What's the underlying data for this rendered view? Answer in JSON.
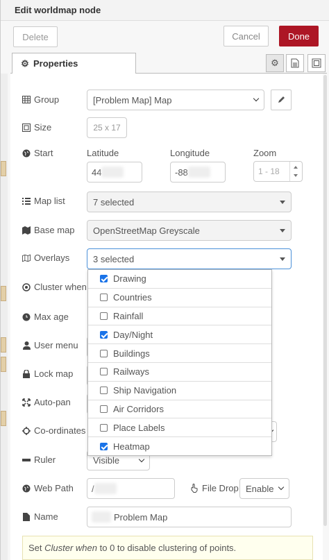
{
  "header": {
    "title": "Edit worldmap node",
    "delete_label": "Delete",
    "cancel_label": "Cancel",
    "done_label": "Done"
  },
  "tabs": {
    "properties_label": "Properties"
  },
  "form": {
    "group": {
      "label": "Group",
      "value": "[Problem Map] Map"
    },
    "size": {
      "label": "Size",
      "value": "25 x 17"
    },
    "start": {
      "label": "Start",
      "latitude_label": "Latitude",
      "latitude_value": "44",
      "longitude_label": "Longitude",
      "longitude_value": "-88",
      "zoom_label": "Zoom",
      "zoom_placeholder": "1 - 18"
    },
    "map_list": {
      "label": "Map list",
      "value": "7 selected"
    },
    "base_map": {
      "label": "Base map",
      "value": "OpenStreetMap Greyscale"
    },
    "overlays": {
      "label": "Overlays",
      "value": "3 selected",
      "options": [
        {
          "label": "Drawing",
          "checked": true
        },
        {
          "label": "Countries",
          "checked": false
        },
        {
          "label": "Rainfall",
          "checked": false
        },
        {
          "label": "Day/Night",
          "checked": true
        },
        {
          "label": "Buildings",
          "checked": false
        },
        {
          "label": "Railways",
          "checked": false
        },
        {
          "label": "Ship Navigation",
          "checked": false
        },
        {
          "label": "Air Corridors",
          "checked": false
        },
        {
          "label": "Place Labels",
          "checked": false
        },
        {
          "label": "Heatmap",
          "checked": true
        }
      ]
    },
    "cluster_when": {
      "label": "Cluster when"
    },
    "max_age": {
      "label": "Max age"
    },
    "user_menu": {
      "label": "User menu"
    },
    "lock_map": {
      "label": "Lock map"
    },
    "auto_pan": {
      "label": "Auto-pan"
    },
    "coordinates": {
      "label": "Co-ordinates"
    },
    "ruler": {
      "label": "Ruler",
      "value": "Visible"
    },
    "web_path": {
      "label": "Web Path",
      "value": "/"
    },
    "file_drop": {
      "label": "File Drop",
      "value": "Enable"
    },
    "name": {
      "label": "Name",
      "value": "Problem Map"
    }
  },
  "tip": {
    "prefix": "Set ",
    "em": "Cluster when",
    "suffix": " to 0 to disable clustering of points."
  },
  "colors": {
    "done": "#ad1625",
    "checkbox": "#1a73e8"
  }
}
